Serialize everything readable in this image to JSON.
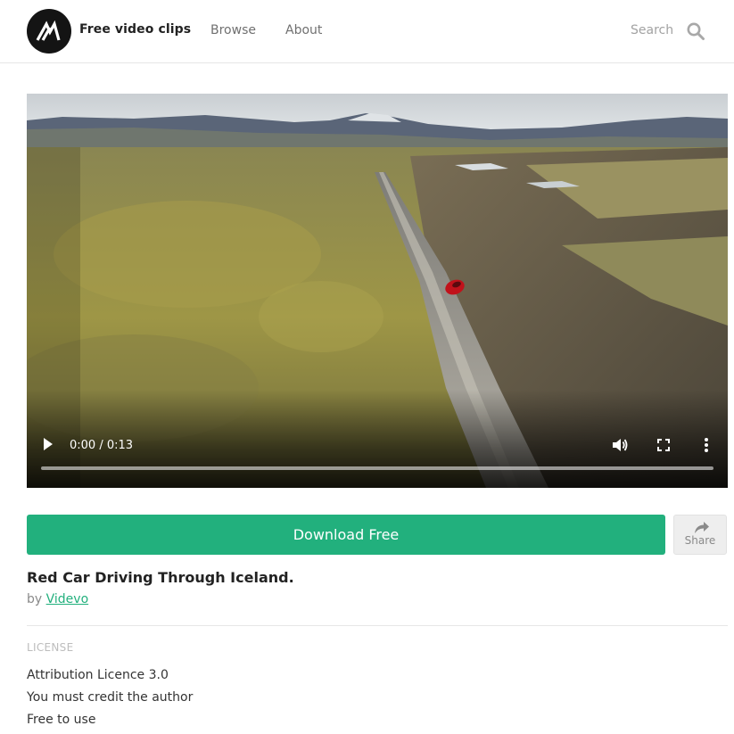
{
  "header": {
    "brand": "Free video clips",
    "nav": [
      {
        "label": "Browse"
      },
      {
        "label": "About"
      }
    ],
    "search_label": "Search"
  },
  "video": {
    "time_display": "0:00 / 0:13",
    "progress_fraction": 0.0,
    "controls": [
      "play-icon",
      "volume-icon",
      "fullscreen-icon",
      "more-options-icon"
    ]
  },
  "actions": {
    "download_label": "Download Free",
    "share_label": "Share"
  },
  "clip": {
    "title": "Red Car Driving Through Iceland.",
    "by_prefix": "by",
    "author": "Videvo"
  },
  "license": {
    "heading": "LICENSE",
    "items": [
      "Attribution Licence 3.0",
      "You must credit the author",
      "Free to use"
    ]
  },
  "colors": {
    "accent": "#22b07d",
    "logo_bg": "#141414"
  }
}
